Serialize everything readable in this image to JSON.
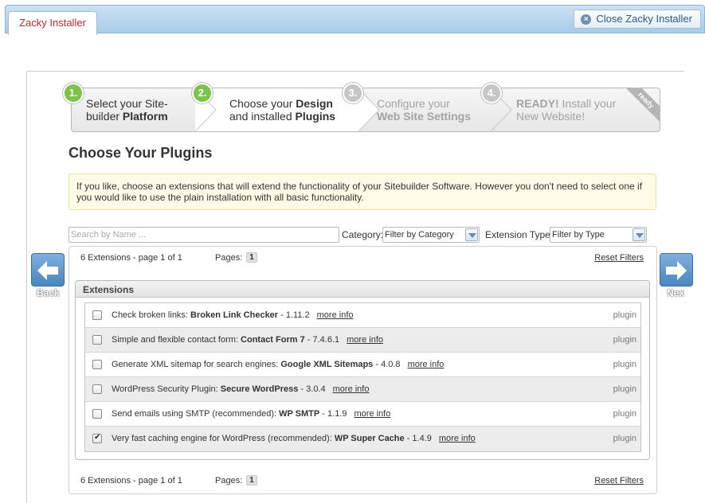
{
  "app": {
    "tab_label": "Zacky Installer",
    "close_label": "Close Zacky Installer"
  },
  "steps": [
    {
      "number": "1.",
      "line1": "Select your Site-",
      "line2_plain": "builder ",
      "line2_bold": "Platform",
      "state": "done"
    },
    {
      "number": "2.",
      "line1_plain": "Choose your ",
      "line1_bold": "Design",
      "line2_plain": "and installed ",
      "line2_bold": "Plugins",
      "state": "current"
    },
    {
      "number": "3.",
      "line1": "Configure your",
      "line2_bold": "Web Site Settings",
      "state": "todo"
    },
    {
      "number": "4.",
      "line1_bold": "READY!",
      "line1_plain": " Install your",
      "line2": "New Website!",
      "state": "todo"
    }
  ],
  "ribbon": "ready",
  "page_title": "Choose Your Plugins",
  "notice": "If you like, choose an extensions that will extend the functionality of your Sitebuilder Software. However you don't need to select one if you would like to use the plain installation with all basic functionality.",
  "filters": {
    "search_placeholder": "Search by Name ...",
    "category_label": "Category:",
    "category_value": "Filter by Category",
    "type_label": "Extension Type:",
    "type_value": "Filter by Type"
  },
  "pager": {
    "count_text": "6 Extensions - page 1 of 1",
    "pages_label": "Pages:",
    "current_page": "1",
    "reset_label": "Reset Filters"
  },
  "group_title": "Extensions",
  "plugins": [
    {
      "desc": "Check broken links: ",
      "name": "Broken Link Checker",
      "version": " - 1.11.2",
      "more": "more info",
      "kind": "plugin",
      "checked": false
    },
    {
      "desc": "Simple and flexible contact form: ",
      "name": "Contact Form 7",
      "version": " - 7.4.6.1",
      "more": "more info",
      "kind": "plugin",
      "checked": false
    },
    {
      "desc": "Generate XML sitemap for search engines: ",
      "name": "Google XML Sitemaps",
      "version": " - 4.0.8",
      "more": "more info",
      "kind": "plugin",
      "checked": false
    },
    {
      "desc": "WordPress Security Plugin: ",
      "name": "Secure WordPress",
      "version": " - 3.0.4",
      "more": "more info",
      "kind": "plugin",
      "checked": false
    },
    {
      "desc": "Send emails using SMTP (recommended): ",
      "name": "WP SMTP",
      "version": " - 1.1.9",
      "more": "more info",
      "kind": "plugin",
      "checked": false
    },
    {
      "desc": "Very fast caching engine for WordPress (recommended): ",
      "name": "WP Super Cache",
      "version": " - 1.4.9",
      "more": "more info",
      "kind": "plugin",
      "checked": true
    }
  ],
  "nav": {
    "back_label": "Back",
    "next_label": "Next"
  },
  "colors": {
    "accent": "#4a86bf",
    "step_done": "#7dc24b",
    "tab_text": "#c0282d"
  }
}
